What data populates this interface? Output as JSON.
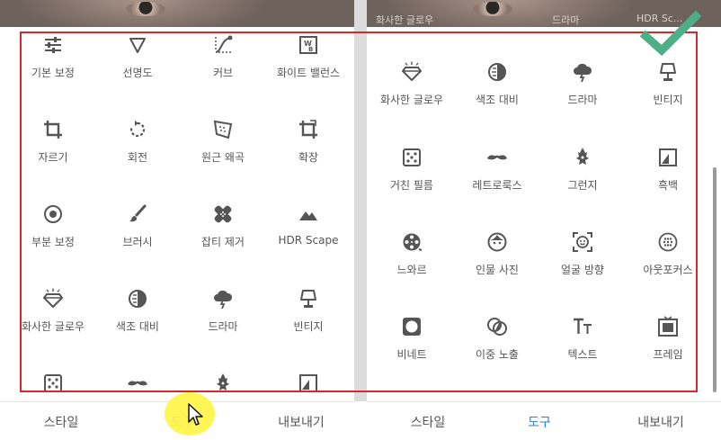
{
  "colors": {
    "accent": "#2a7ee0",
    "selection_frame": "#d9272e",
    "checkmark": "#4caf87",
    "icon": "#555555",
    "cursor_highlight": "#fff546"
  },
  "left_panel": {
    "tools": [
      {
        "label": "기본 보정",
        "icon": "sliders-icon"
      },
      {
        "label": "선명도",
        "icon": "triangle-down-icon"
      },
      {
        "label": "커브",
        "icon": "curve-icon"
      },
      {
        "label": "화이트 밸런스",
        "icon": "white-balance-icon"
      },
      {
        "label": "자르기",
        "icon": "crop-icon"
      },
      {
        "label": "회전",
        "icon": "rotate-icon"
      },
      {
        "label": "원근 왜곡",
        "icon": "perspective-icon"
      },
      {
        "label": "확장",
        "icon": "expand-icon"
      },
      {
        "label": "부분 보정",
        "icon": "selective-icon"
      },
      {
        "label": "브러시",
        "icon": "brush-icon"
      },
      {
        "label": "잡티 제거",
        "icon": "healing-icon"
      },
      {
        "label": "HDR Scape",
        "icon": "mountain-icon"
      },
      {
        "label": "화사한 글로우",
        "icon": "diamond-icon"
      },
      {
        "label": "색조 대비",
        "icon": "tonal-contrast-icon"
      },
      {
        "label": "드라마",
        "icon": "cloud-icon"
      },
      {
        "label": "빈티지",
        "icon": "lamp-icon"
      },
      {
        "label": "",
        "icon": "dice-icon"
      },
      {
        "label": "",
        "icon": "mustache-icon"
      },
      {
        "label": "",
        "icon": "guitar-icon"
      },
      {
        "label": "",
        "icon": "bw-icon"
      }
    ],
    "tabs": {
      "styles": "스타일",
      "tools": "도구",
      "export": "내보내기"
    }
  },
  "right_panel": {
    "top_overlay": [
      "화사한 글로우",
      "색조 대비",
      "드라마",
      "HDR Sc..."
    ],
    "tools": [
      {
        "label": "화사한 글로우",
        "icon": "diamond-icon"
      },
      {
        "label": "색조 대비",
        "icon": "tonal-contrast-icon"
      },
      {
        "label": "드라마",
        "icon": "cloud-icon"
      },
      {
        "label": "빈티지",
        "icon": "lamp-icon"
      },
      {
        "label": "거친 필름",
        "icon": "dice-icon"
      },
      {
        "label": "레트로룩스",
        "icon": "mustache-icon"
      },
      {
        "label": "그런지",
        "icon": "guitar-icon"
      },
      {
        "label": "흑백",
        "icon": "bw-icon"
      },
      {
        "label": "느와르",
        "icon": "film-reel-icon"
      },
      {
        "label": "인물 사진",
        "icon": "face-icon"
      },
      {
        "label": "얼굴 방향",
        "icon": "face-focus-icon"
      },
      {
        "label": "아웃포커스",
        "icon": "lens-blur-icon"
      },
      {
        "label": "비네트",
        "icon": "vignette-icon"
      },
      {
        "label": "이중 노출",
        "icon": "double-exposure-icon"
      },
      {
        "label": "텍스트",
        "icon": "text-icon"
      },
      {
        "label": "프레임",
        "icon": "frame-icon"
      }
    ],
    "tabs": {
      "styles": "스타일",
      "tools": "도구",
      "export": "내보내기"
    }
  }
}
